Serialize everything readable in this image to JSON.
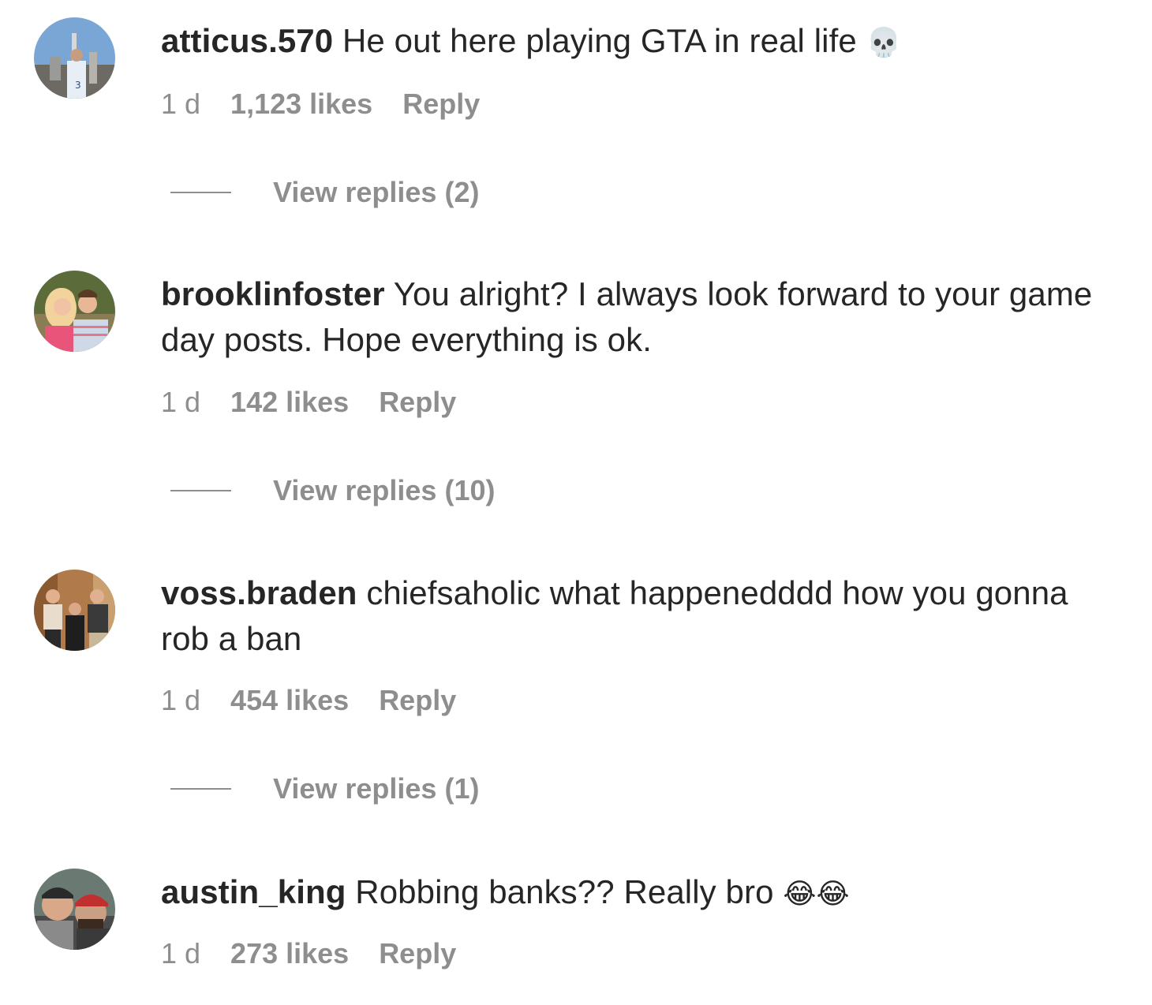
{
  "comments": [
    {
      "username": "atticus.570",
      "text": "He out here playing GTA in real life",
      "emoji": "💀",
      "time": "1 d",
      "likes": "1,123 likes",
      "reply": "Reply",
      "view_replies": "View replies (2)"
    },
    {
      "username": "brooklinfoster",
      "text": "You alright? I always look forward to your game day posts. Hope everything is ok.",
      "emoji": "",
      "time": "1 d",
      "likes": "142 likes",
      "reply": "Reply",
      "view_replies": "View replies (10)"
    },
    {
      "username": "voss.braden",
      "text": "chiefsaholic what happenedddd how you gonna rob a ban",
      "emoji": "",
      "time": "1 d",
      "likes": "454 likes",
      "reply": "Reply",
      "view_replies": "View replies (1)"
    },
    {
      "username": "austin_king",
      "text": "Robbing banks?? Really bro",
      "emoji": "😂😂",
      "time": "1 d",
      "likes": "273 likes",
      "reply": "Reply"
    }
  ]
}
